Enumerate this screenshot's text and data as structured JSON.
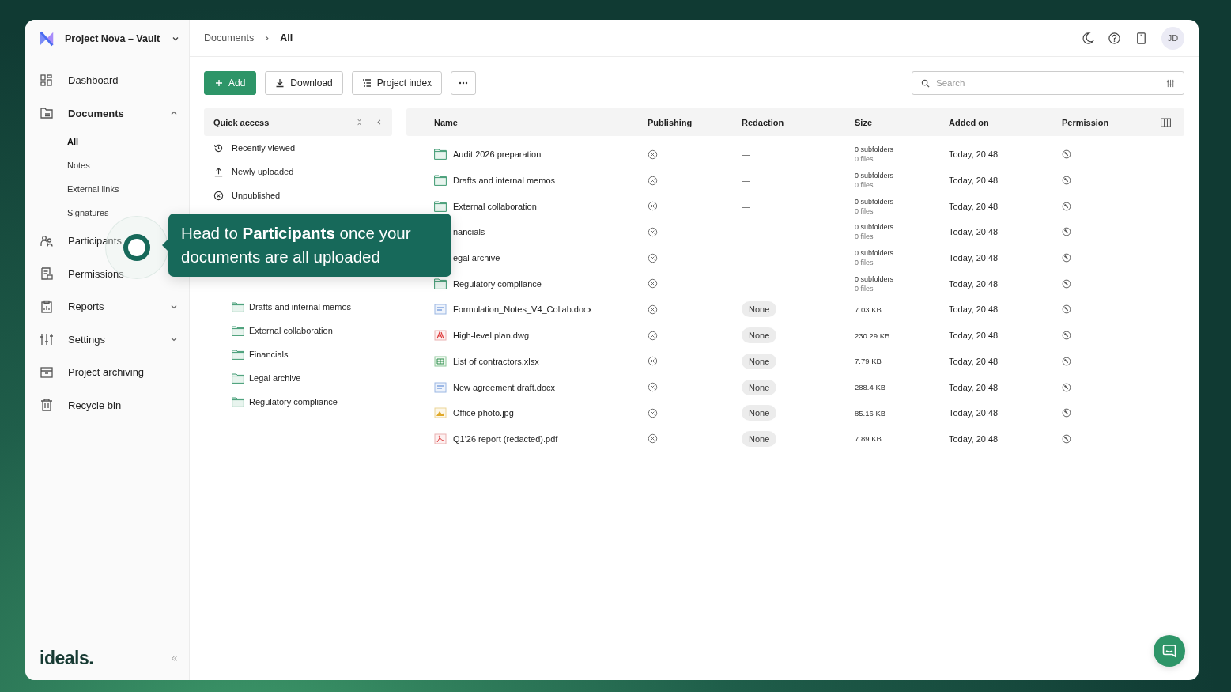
{
  "project": {
    "name": "Project Nova – Vault"
  },
  "breadcrumbs": [
    {
      "label": "Documents",
      "selected": false
    },
    {
      "label": "All",
      "selected": true
    }
  ],
  "user": {
    "initials": "JD"
  },
  "sidebar": {
    "items": [
      {
        "label": "Dashboard",
        "kind": "link"
      },
      {
        "label": "Documents",
        "kind": "group",
        "expanded": true,
        "children": [
          {
            "label": "All",
            "selected": true
          },
          {
            "label": "Notes",
            "selected": false
          },
          {
            "label": "External links",
            "selected": false
          },
          {
            "label": "Signatures",
            "selected": false
          }
        ]
      },
      {
        "label": "Participants",
        "kind": "link"
      },
      {
        "label": "Permissions",
        "kind": "link"
      },
      {
        "label": "Reports",
        "kind": "group",
        "expanded": false
      },
      {
        "label": "Settings",
        "kind": "group",
        "expanded": false
      },
      {
        "label": "Project archiving",
        "kind": "link"
      },
      {
        "label": "Recycle bin",
        "kind": "link"
      }
    ],
    "brand": "ideals."
  },
  "toolbar": {
    "buttons": [
      {
        "label": "Add",
        "kind": "primary"
      },
      {
        "label": "Download",
        "kind": "download"
      },
      {
        "label": "Project index",
        "kind": "index"
      },
      {
        "kind": "more"
      }
    ]
  },
  "search": {
    "placeholder": "Search"
  },
  "quick_access": {
    "title": "Quick access",
    "items": [
      "Recently viewed",
      "Newly uploaded",
      "Unpublished"
    ],
    "folders": [
      "Drafts and internal memos",
      "External collaboration",
      "Financials",
      "Legal archive",
      "Regulatory compliance"
    ]
  },
  "table": {
    "columns": [
      "Name",
      "Publishing",
      "Redaction",
      "Size",
      "Added on",
      "Permission"
    ],
    "rows": [
      {
        "name": "Audit 2026 preparation",
        "kind": "folder",
        "redaction": "—",
        "size": [
          "0 subfolders",
          "0 files"
        ],
        "added": "Today, 20:48"
      },
      {
        "name": "Drafts and internal memos",
        "kind": "folder",
        "redaction": "—",
        "size": [
          "0 subfolders",
          "0 files"
        ],
        "added": "Today, 20:48"
      },
      {
        "name": "External collaboration",
        "kind": "folder",
        "redaction": "—",
        "size": [
          "0 subfolders",
          "0 files"
        ],
        "added": "Today, 20:48"
      },
      {
        "name": "nancials",
        "kind": "folder-hidden-icon",
        "redaction": "—",
        "size": [
          "0 subfolders",
          "0 files"
        ],
        "added": "Today, 20:48"
      },
      {
        "name": "egal archive",
        "kind": "folder-hidden-icon",
        "redaction": "—",
        "size": [
          "0 subfolders",
          "0 files"
        ],
        "added": "Today, 20:48"
      },
      {
        "name": "Regulatory compliance",
        "kind": "folder",
        "redaction": "—",
        "size": [
          "0 subfolders",
          "0 files"
        ],
        "added": "Today, 20:48"
      },
      {
        "name": "Formulation_Notes_V4_Collab.docx",
        "kind": "doc",
        "redaction": "None",
        "size": [
          "7.03 KB"
        ],
        "added": "Today, 20:48"
      },
      {
        "name": "High-level plan.dwg",
        "kind": "drawing",
        "redaction": "None",
        "size": [
          "230.29 KB"
        ],
        "added": "Today, 20:48"
      },
      {
        "name": "List of contractors.xlsx",
        "kind": "sheet",
        "redaction": "None",
        "size": [
          "7.79 KB"
        ],
        "added": "Today, 20:48"
      },
      {
        "name": "New agreement draft.docx",
        "kind": "doc",
        "redaction": "None",
        "size": [
          "288.4 KB"
        ],
        "added": "Today, 20:48"
      },
      {
        "name": "Office photo.jpg",
        "kind": "image",
        "redaction": "None",
        "size": [
          "85.16 KB"
        ],
        "added": "Today, 20:48"
      },
      {
        "name": "Q1'26 report (redacted).pdf",
        "kind": "pdf",
        "redaction": "None",
        "size": [
          "7.89 KB"
        ],
        "added": "Today, 20:48"
      }
    ]
  },
  "tooltip": {
    "text": "Head to **Participants** once your documents are all uploaded"
  }
}
